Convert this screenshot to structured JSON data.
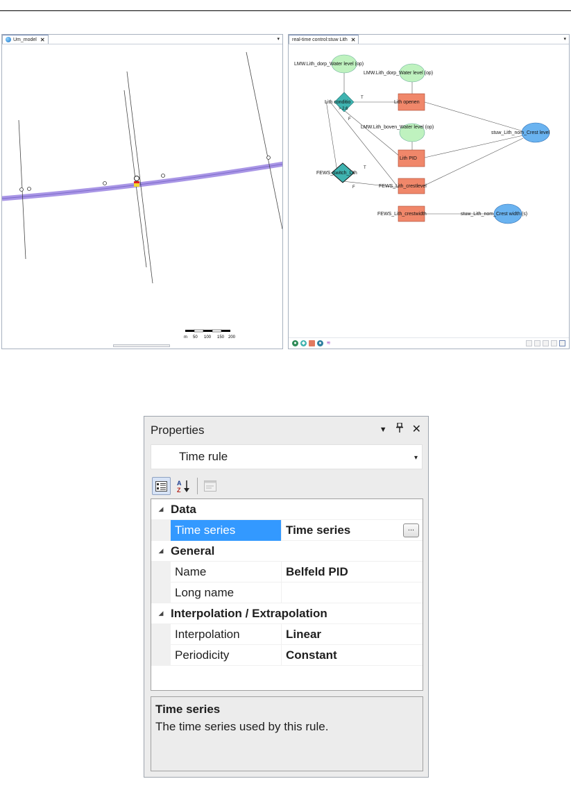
{
  "map_panel": {
    "tab_label": "Um_model",
    "tab_close": "✕",
    "menu_glyph": "▾",
    "scale": {
      "unit": "m",
      "ticks": [
        "50",
        "100",
        "150",
        "200"
      ]
    }
  },
  "flow_panel": {
    "tab_label": "real-time control:stuw Lith",
    "tab_close": "✕",
    "menu_glyph": "▾",
    "nodes": {
      "input_dorp_1": "LMW.Lith_dorp_Water level (op)",
      "input_dorp_2": "LMW.Lith_dorp_Water level (op)",
      "condition": "Lith conditio",
      "condition_value": "> 2.6",
      "true_label_1": "T",
      "false_label_1": "F",
      "action_openen": "Lith openen",
      "input_boven": "LMW.Lith_boven_Water level (op)",
      "action_pid": "Lith PID",
      "output_crest_level": "stuw_Lith_nom_Crest level",
      "switch": "FEWS_switch_Lith",
      "true_label_2": "T",
      "false_label_2": "F",
      "fews_crestlevel": "FEWS_Lith_crestlevel",
      "fews_crestwidth": "FEWS_Lith_crestwidth",
      "output_crest_width": "stuw_Lith_nom_Crest width (s)"
    }
  },
  "properties": {
    "title": "Properties",
    "header_icons": {
      "dropdown": "▼",
      "pin": "📌",
      "close": "✕"
    },
    "selected_object": "Time rule",
    "combo_arrow": "▾",
    "ellipsis": "...",
    "categories": [
      {
        "label": "Data",
        "rows": [
          {
            "name": "Time series",
            "value": "Time series",
            "selected": true
          }
        ]
      },
      {
        "label": "General",
        "rows": [
          {
            "name": "Name",
            "value": "Belfeld PID"
          },
          {
            "name": "Long name",
            "value": ""
          }
        ]
      },
      {
        "label": "Interpolation / Extrapolation",
        "rows": [
          {
            "name": "Interpolation",
            "value": "Linear"
          },
          {
            "name": "Periodicity",
            "value": "Constant"
          }
        ]
      }
    ],
    "description": {
      "title": "Time series",
      "text": "The time series used by this rule."
    }
  },
  "colors": {
    "selection": "#3399ff",
    "river": "#a996e6",
    "input_node": "#bff2bf",
    "condition_node": "#3fb3b0",
    "action_node": "#f0876a",
    "output_node": "#6ab3f0"
  }
}
